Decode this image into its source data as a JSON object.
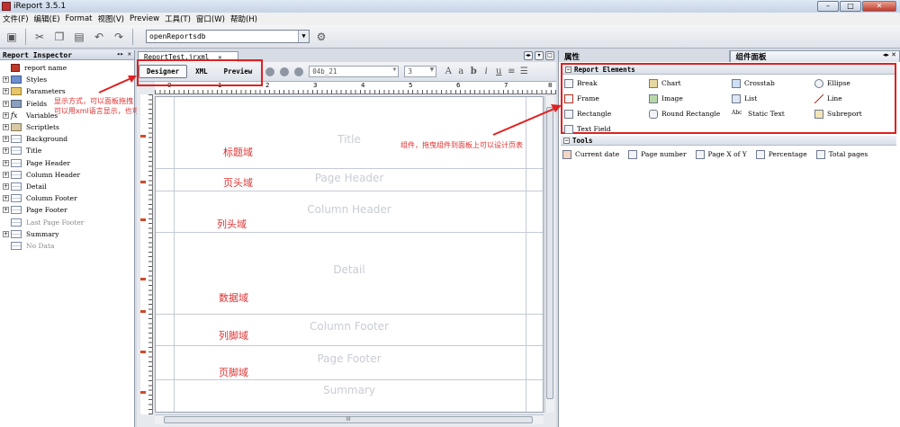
{
  "window": {
    "title": "iReport 3.5.1",
    "min": "–",
    "max": "□",
    "close": "✕"
  },
  "menu": [
    "文件(F)",
    "编辑(E)",
    "Format",
    "视图(V)",
    "Preview",
    "工具(T)",
    "窗口(W)",
    "帮助(H)"
  ],
  "toolbar": {
    "connection_value": "openReportsdb"
  },
  "inspector": {
    "title": "Report Inspector",
    "items": [
      {
        "label": "report name",
        "icon": "report-icon",
        "expand": ""
      },
      {
        "label": "Styles",
        "icon": "styles-icon",
        "expand": "+"
      },
      {
        "label": "Parameters",
        "icon": "parameters-icon",
        "expand": "+"
      },
      {
        "label": "Fields",
        "icon": "fields-icon",
        "expand": "+"
      },
      {
        "label": "Variables",
        "icon": "fx-icon",
        "expand": "+"
      },
      {
        "label": "Scriptlets",
        "icon": "scriptlets-icon",
        "expand": "+"
      },
      {
        "label": "Background",
        "icon": "band-icon",
        "expand": "+"
      },
      {
        "label": "Title",
        "icon": "band-icon",
        "expand": "+"
      },
      {
        "label": "Page Header",
        "icon": "band-icon",
        "expand": "+"
      },
      {
        "label": "Column Header",
        "icon": "band-icon",
        "expand": "+"
      },
      {
        "label": "Detail",
        "icon": "band-icon",
        "expand": "+"
      },
      {
        "label": "Column Footer",
        "icon": "band-icon",
        "expand": "+"
      },
      {
        "label": "Page Footer",
        "icon": "band-icon",
        "expand": "+"
      },
      {
        "label": "Last Page Footer",
        "icon": "band-icon",
        "expand": ""
      },
      {
        "label": "Summary",
        "icon": "band-icon",
        "expand": "+"
      },
      {
        "label": "No Data",
        "icon": "band-icon",
        "expand": ""
      }
    ],
    "annotation_line1": "显示方式，可以面板拖拽",
    "annotation_line2": "可以用xml语言显示，也可以预览"
  },
  "editor": {
    "tab_label": "ReportTest.jrxml",
    "tab_close": "✕",
    "views": [
      "Designer",
      "XML",
      "Preview"
    ],
    "font_value": "04b_21",
    "size_value": "3",
    "ruler_numbers": [
      "0",
      "1",
      "2",
      "3",
      "4",
      "5",
      "6",
      "7",
      "8"
    ],
    "bands": [
      {
        "en": "Title",
        "cn": "标题域"
      },
      {
        "en": "Page Header",
        "cn": "页头域"
      },
      {
        "en": "Column Header",
        "cn": "列头域"
      },
      {
        "en": "Detail",
        "cn": "数据域"
      },
      {
        "en": "Column Footer",
        "cn": "列脚域"
      },
      {
        "en": "Page Footer",
        "cn": "页脚域"
      },
      {
        "en": "Summary",
        "cn": ""
      }
    ],
    "hscroll_grip": "III"
  },
  "right_panel": {
    "tabs": [
      "属性",
      "组件面板"
    ],
    "report_elements_title": "Report Elements",
    "elements": [
      "Break",
      "Chart",
      "Crosstab",
      "Ellipse",
      "Frame",
      "Image",
      "List",
      "Line",
      "Rectangle",
      "Round Rectangle",
      "Static Text",
      "Subreport",
      "Text Field"
    ],
    "tools_title": "Tools",
    "tools": [
      "Current date",
      "Page number",
      "Page X of Y",
      "Percentage",
      "Total pages"
    ],
    "annotation": "组件，拖曳组件到面板上可以设计页表"
  },
  "colors": {
    "annotation_red": "#e03030",
    "band_text": "#c8ccd4"
  }
}
